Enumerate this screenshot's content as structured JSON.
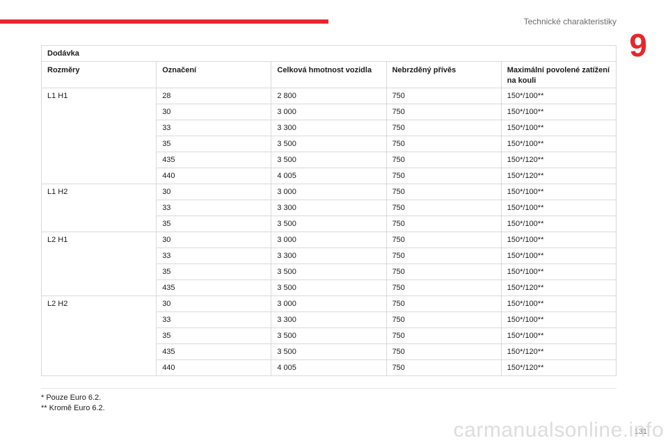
{
  "header": {
    "section_title": "Technické charakteristiky",
    "chapter_number": "9",
    "accent_color": "#e8262d"
  },
  "table": {
    "caption": "Dodávka",
    "columns": [
      "Rozměry",
      "Označení",
      "Celková hmotnost vozidla",
      "Nebrzděný přívěs",
      "Maximální povolené zatížení na kouli"
    ],
    "groups": [
      {
        "dimension": "L1 H1",
        "rows": [
          [
            "28",
            "2 800",
            "750",
            "150*/100**"
          ],
          [
            "30",
            "3 000",
            "750",
            "150*/100**"
          ],
          [
            "33",
            "3 300",
            "750",
            "150*/100**"
          ],
          [
            "35",
            "3 500",
            "750",
            "150*/100**"
          ],
          [
            "435",
            "3 500",
            "750",
            "150*/120**"
          ],
          [
            "440",
            "4 005",
            "750",
            "150*/120**"
          ]
        ]
      },
      {
        "dimension": "L1 H2",
        "rows": [
          [
            "30",
            "3 000",
            "750",
            "150*/100**"
          ],
          [
            "33",
            "3 300",
            "750",
            "150*/100**"
          ],
          [
            "35",
            "3 500",
            "750",
            "150*/100**"
          ]
        ]
      },
      {
        "dimension": "L2 H1",
        "rows": [
          [
            "30",
            "3 000",
            "750",
            "150*/100**"
          ],
          [
            "33",
            "3 300",
            "750",
            "150*/100**"
          ],
          [
            "35",
            "3 500",
            "750",
            "150*/100**"
          ],
          [
            "435",
            "3 500",
            "750",
            "150*/120**"
          ]
        ]
      },
      {
        "dimension": "L2 H2",
        "rows": [
          [
            "30",
            "3 000",
            "750",
            "150*/100**"
          ],
          [
            "33",
            "3 300",
            "750",
            "150*/100**"
          ],
          [
            "35",
            "3 500",
            "750",
            "150*/100**"
          ],
          [
            "435",
            "3 500",
            "750",
            "150*/120**"
          ],
          [
            "440",
            "4 005",
            "750",
            "150*/120**"
          ]
        ]
      }
    ]
  },
  "footnotes": [
    "* Pouze Euro 6.2.",
    "** Kromě Euro 6.2."
  ],
  "page_number": "131",
  "watermark": "carmanualsonline.info"
}
